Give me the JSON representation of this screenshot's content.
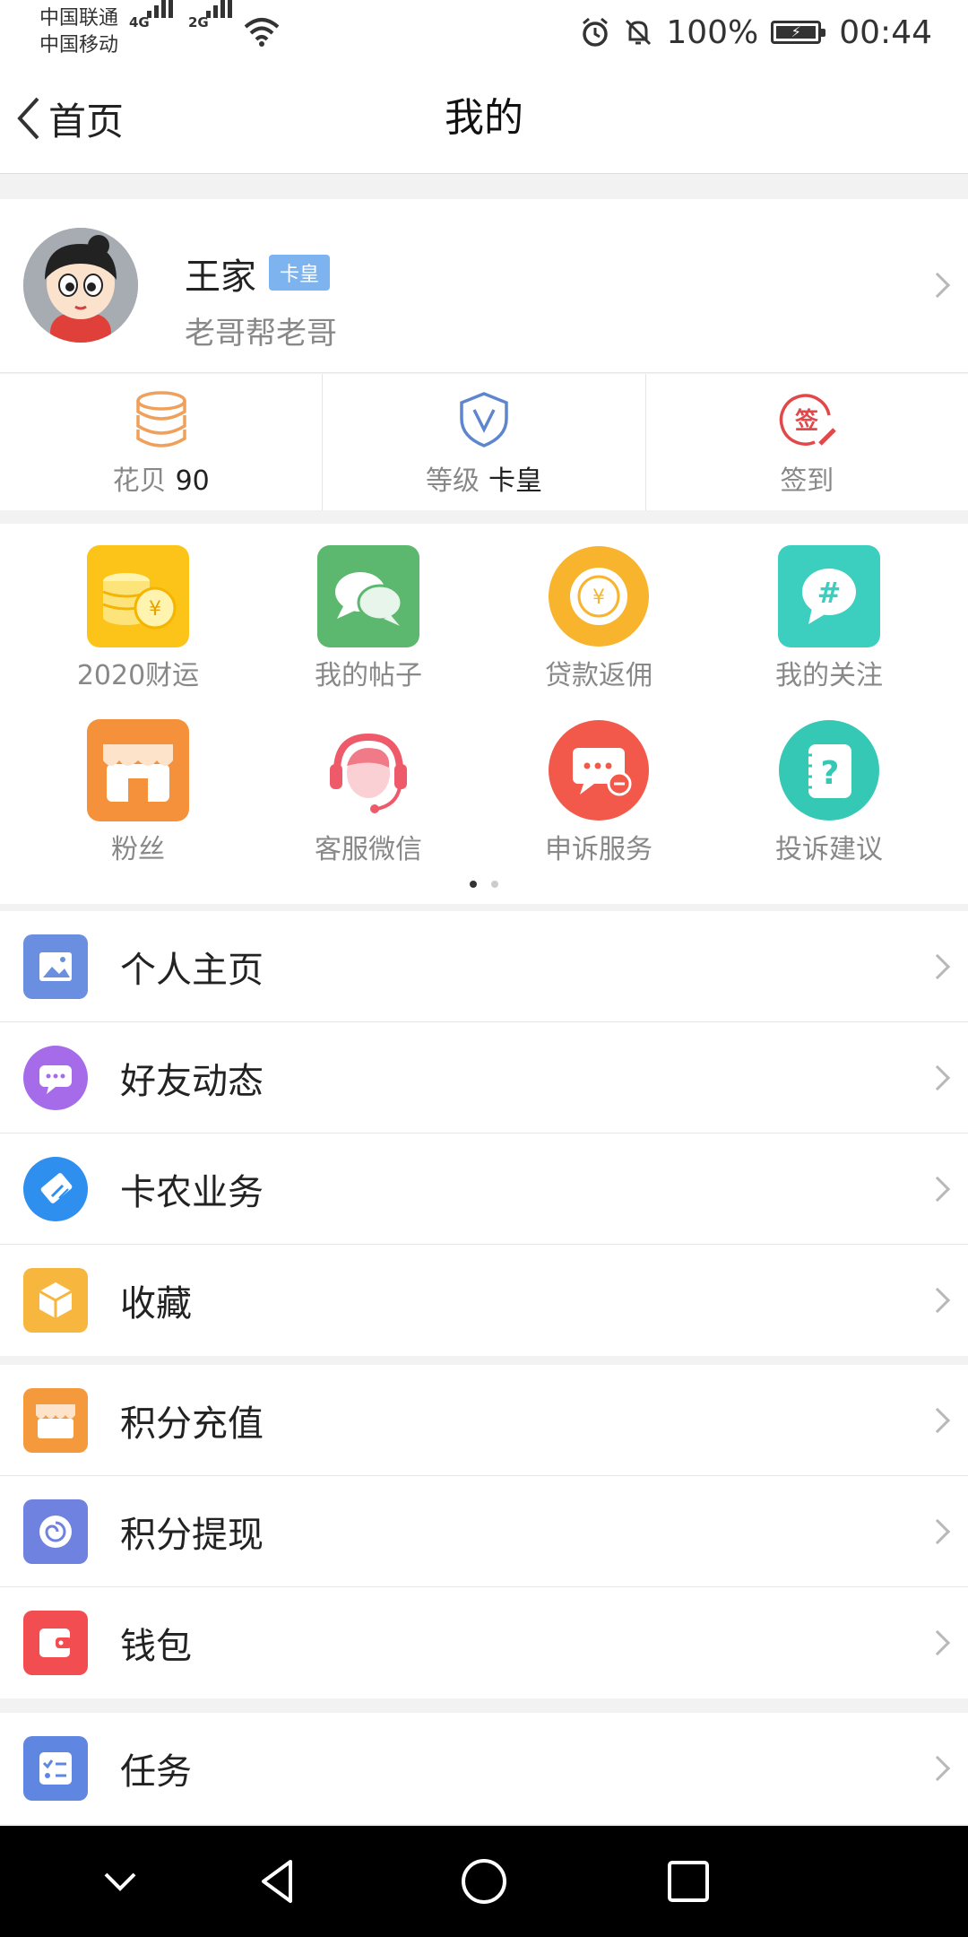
{
  "status_bar": {
    "carrier_1": "中国联通",
    "carrier_2": "中国移动",
    "net_1": "4G",
    "net_2": "2G",
    "battery": "100%",
    "time": "00:44"
  },
  "nav": {
    "back_label": "首页",
    "title": "我的"
  },
  "profile": {
    "name": "王家",
    "badge": "卡皇",
    "subtitle": "老哥帮老哥"
  },
  "stats": [
    {
      "label": "花贝",
      "value": "90",
      "icon": "coin-stack-icon"
    },
    {
      "label": "等级",
      "value": "卡皇",
      "icon": "shield-v-icon"
    },
    {
      "label": "签到",
      "value": "",
      "icon": "checkin-icon"
    }
  ],
  "grid": {
    "items": [
      {
        "label": "2020财运",
        "icon": "coins-yen-icon"
      },
      {
        "label": "我的帖子",
        "icon": "chat-bubbles-icon"
      },
      {
        "label": "贷款返佣",
        "icon": "yen-coin-icon"
      },
      {
        "label": "我的关注",
        "icon": "hashtag-icon"
      },
      {
        "label": "粉丝",
        "icon": "shop-icon"
      },
      {
        "label": "客服微信",
        "icon": "headset-agent-icon"
      },
      {
        "label": "申诉服务",
        "icon": "message-minus-icon"
      },
      {
        "label": "投诉建议",
        "icon": "question-note-icon"
      }
    ],
    "page_count": 2,
    "current_page": 1
  },
  "menu_group_1": [
    {
      "label": "个人主页",
      "icon": "picture-icon",
      "color": "#6b8fe0"
    },
    {
      "label": "好友动态",
      "icon": "chat-dots-icon",
      "color": "#a66be8"
    },
    {
      "label": "卡农业务",
      "icon": "handshake-icon",
      "color": "#2e8fef"
    },
    {
      "label": "收藏",
      "icon": "box-icon",
      "color": "#f7b63e"
    }
  ],
  "menu_group_2": [
    {
      "label": "积分充值",
      "icon": "store-icon",
      "color": "#f59a3c"
    },
    {
      "label": "积分提现",
      "icon": "spiral-icon",
      "color": "#6f82e0"
    },
    {
      "label": "钱包",
      "icon": "wallet-icon",
      "color": "#f24d50"
    }
  ],
  "menu_group_3": [
    {
      "label": "任务",
      "icon": "checklist-icon",
      "color": "#5f86e0"
    }
  ]
}
